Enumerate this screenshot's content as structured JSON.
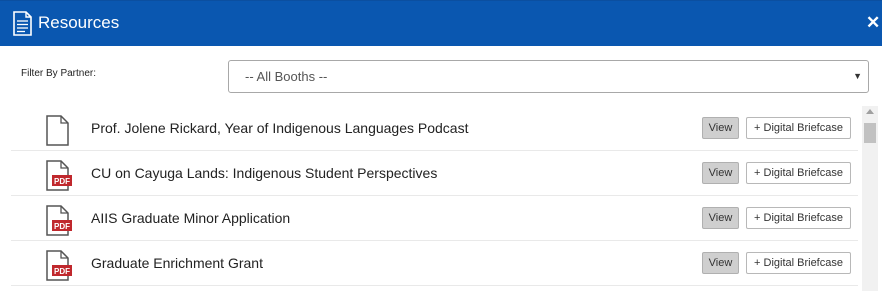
{
  "header": {
    "title": "Resources",
    "doc_icon": "document-icon",
    "close_icon": "close-icon",
    "color": "#0a57b0"
  },
  "filter": {
    "label": "Filter By Partner:",
    "selected": "-- All Booths --"
  },
  "resources": [
    {
      "title": "Prof. Jolene Rickard, Year of Indigenous Languages Podcast",
      "icon": "file-icon",
      "badge": "",
      "view_label": "View",
      "briefcase_label": "+ Digital Briefcase"
    },
    {
      "title": "CU on Cayuga Lands: Indigenous Student Perspectives",
      "icon": "pdf-icon",
      "badge": "PDF",
      "view_label": "View",
      "briefcase_label": "+ Digital Briefcase"
    },
    {
      "title": "AIIS Graduate Minor Application",
      "icon": "pdf-icon",
      "badge": "PDF",
      "view_label": "View",
      "briefcase_label": "+ Digital Briefcase"
    },
    {
      "title": "Graduate Enrichment Grant",
      "icon": "pdf-icon",
      "badge": "PDF",
      "view_label": "View",
      "briefcase_label": "+ Digital Briefcase"
    }
  ],
  "colors": {
    "pdf_badge": "#c0282d",
    "view_button": "#cfcfcf"
  }
}
